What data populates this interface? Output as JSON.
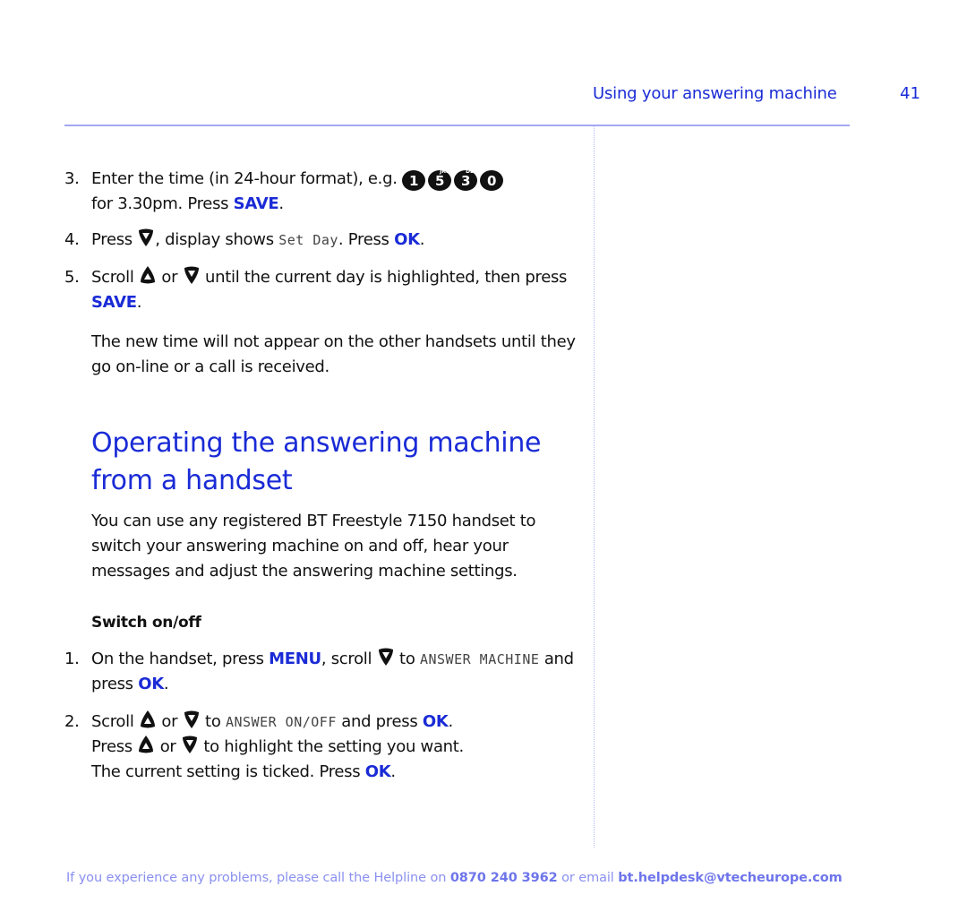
{
  "header": {
    "title": "Using your answering machine",
    "page_number": "41"
  },
  "steps_top": [
    {
      "number": "3.",
      "parts": {
        "a": "Enter the time (in 24-hour format), e.g. ",
        "keys": [
          {
            "digit": "1",
            "letters": ""
          },
          {
            "digit": "5",
            "letters": "JKL"
          },
          {
            "digit": "3",
            "letters": "DEF"
          },
          {
            "digit": "0",
            "letters": ""
          }
        ],
        "b": "for 3.30pm. Press ",
        "kw1": "SAVE",
        "c": "."
      }
    },
    {
      "number": "4.",
      "parts": {
        "a": "Press ",
        "icon1": "down-arrow-key",
        "b": ", display shows ",
        "lcd": "Set Day",
        "c": ". Press ",
        "kw1": "OK",
        "d": "."
      }
    },
    {
      "number": "5.",
      "parts": {
        "a": "Scroll ",
        "icon1": "up-arrow-key",
        "b": " or ",
        "icon2": "down-arrow-key",
        "c": " until the current day is highlighted, then press ",
        "kw1": "SAVE",
        "d": "."
      }
    }
  ],
  "note": "The new time will not appear on the other handsets until they go on-line or a call is received.",
  "section": {
    "title": "Operating the answering machine from a handset",
    "intro": "You can use any registered BT Freestyle 7150 handset to switch your answering machine on and off, hear your messages and adjust the answering machine settings.",
    "subheading": "Switch on/off",
    "steps": [
      {
        "number": "1.",
        "parts": {
          "a": "On the handset, press ",
          "kw1": "MENU",
          "b": ", scroll ",
          "icon1": "down-arrow-key",
          "c": " to ",
          "lcd": "ANSWER MACHINE",
          "d": " and press ",
          "kw2": "OK",
          "e": "."
        }
      },
      {
        "number": "2.",
        "parts": {
          "a": "Scroll ",
          "icon1": "up-arrow-key",
          "b": " or ",
          "icon2": "down-arrow-key",
          "c": " to ",
          "lcd": "ANSWER ON/OFF",
          "d": " and press ",
          "kw1": "OK",
          "e": ".",
          "line2a": "Press ",
          "icon3": "up-arrow-key",
          "line2b": " or ",
          "icon4": "down-arrow-key",
          "line2c": " to highlight the setting you want.",
          "line3a": "The current setting is ticked. Press ",
          "kw2": "OK",
          "line3b": "."
        }
      }
    ]
  },
  "footer": {
    "text_a": "If you experience any problems, please call the Helpline on ",
    "phone": "0870 240 3962",
    "text_b": " or email ",
    "email": "bt.helpdesk@vtecheurope.com"
  },
  "colors": {
    "accent_blue": "#1a2bd6",
    "rule_lavender": "#a3a8f2",
    "footer_text": "#8a90ef"
  }
}
